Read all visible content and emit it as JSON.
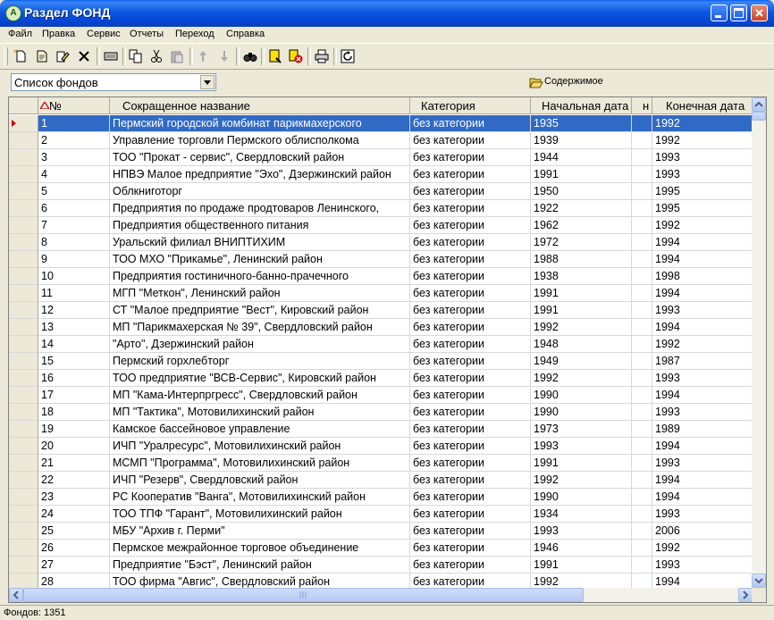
{
  "window": {
    "title": "Раздел ФОНД"
  },
  "menu": [
    "Файл",
    "Правка",
    "Сервис",
    "Отчеты",
    "Переход",
    "Справка"
  ],
  "toolbar": [
    "new-icon",
    "edit-icon",
    "properties-icon",
    "delete-icon",
    "keyboard-icon",
    "copy-icon",
    "cut-icon",
    "paste-icon",
    "move-up-icon",
    "move-down-icon",
    "find-icon",
    "note-icon",
    "filter-clear-icon",
    "print-icon",
    "refresh-icon"
  ],
  "filter": {
    "selected": "Список фондов",
    "contents_label": "Содержимое"
  },
  "grid": {
    "columns": [
      "№",
      "Сокращенное название",
      "Категория",
      "Начальная дата",
      "н",
      "Конечная дата"
    ],
    "rows": [
      [
        "1",
        "Пермский городской комбинат парикмахерского",
        "без категории",
        "1935",
        "",
        "1992"
      ],
      [
        "2",
        "Управление торговли Пермского облисполкома",
        "без категории",
        "1939",
        "",
        "1992"
      ],
      [
        "3",
        "ТОО \"Прокат - сервис\", Свердловский район",
        "без категории",
        "1944",
        "",
        "1993"
      ],
      [
        "4",
        "НПВЭ Малое предприятие \"Эхо\", Дзержинский район",
        "без категории",
        "1991",
        "",
        "1993"
      ],
      [
        "5",
        "Облкниготорг",
        "без категории",
        "1950",
        "",
        "1995"
      ],
      [
        "6",
        "Предприятия по продаже продтоваров Ленинского,",
        "без категории",
        "1922",
        "",
        "1995"
      ],
      [
        "7",
        "Предприятия общественного питания",
        "без категории",
        "1962",
        "",
        "1992"
      ],
      [
        "8",
        "Уральский филиал ВНИПТИХИМ",
        "без категории",
        "1972",
        "",
        "1994"
      ],
      [
        "9",
        "ТОО МХО \"Прикамье\", Ленинский район",
        "без категории",
        "1988",
        "",
        "1994"
      ],
      [
        "10",
        "Предприятия гостиничного-банно-прачечного",
        "без категории",
        "1938",
        "",
        "1998"
      ],
      [
        "11",
        "МГП \"Меткон\", Ленинский район",
        "без категории",
        "1991",
        "",
        "1994"
      ],
      [
        "12",
        "СТ \"Малое предприятие \"Вест\", Кировский район",
        "без категории",
        "1991",
        "",
        "1993"
      ],
      [
        "13",
        "МП \"Парикмахерская № 39\", Свердловский район",
        "без категории",
        "1992",
        "",
        "1994"
      ],
      [
        "14",
        "\"Арто\", Дзержинский район",
        "без категории",
        "1948",
        "",
        "1992"
      ],
      [
        "15",
        "Пермский горхлебторг",
        "без категории",
        "1949",
        "",
        "1987"
      ],
      [
        "16",
        "ТОО предприятие \"ВСВ-Сервис\", Кировский район",
        "без категории",
        "1992",
        "",
        "1993"
      ],
      [
        "17",
        "МП \"Кама-Интерпргресс\", Свердловский район",
        "без категории",
        "1990",
        "",
        "1994"
      ],
      [
        "18",
        "МП \"Тактика\", Мотовилихинский район",
        "без категории",
        "1990",
        "",
        "1993"
      ],
      [
        "19",
        "Камское бассейновое управление",
        "без категории",
        "1973",
        "",
        "1989"
      ],
      [
        "20",
        "ИЧП \"Уралресурс\", Мотовилихинский район",
        "без категории",
        "1993",
        "",
        "1994"
      ],
      [
        "21",
        "МСМП \"Программа\", Мотовилихинский район",
        "без категории",
        "1991",
        "",
        "1993"
      ],
      [
        "22",
        "ИЧП \"Резерв\", Свердловский район",
        "без категории",
        "1992",
        "",
        "1994"
      ],
      [
        "23",
        "РС Кооператив \"Ванга\", Мотовилихинский район",
        "без категории",
        "1990",
        "",
        "1994"
      ],
      [
        "24",
        "ТОО ТПФ \"Гарант\", Мотовилихинский район",
        "без категории",
        "1934",
        "",
        "1993"
      ],
      [
        "25",
        "МБУ \"Архив г. Перми\"",
        "без категории",
        "1993",
        "",
        "2006"
      ],
      [
        "26",
        "Пермское межрайонное торговое объединение",
        "без категории",
        "1946",
        "",
        "1992"
      ],
      [
        "27",
        "Предприятие \"Бэст\", Ленинский район",
        "без категории",
        "1991",
        "",
        "1993"
      ],
      [
        "28",
        "ТОО фирма \"Авгис\", Свердловский район",
        "без категории",
        "1992",
        "",
        "1994"
      ]
    ]
  },
  "status": {
    "count_text": "Фондов: 1351"
  },
  "colors": {
    "title_bar": "#0a57e0",
    "selection": "#316ac5",
    "sort_indicator": "#c00000"
  }
}
